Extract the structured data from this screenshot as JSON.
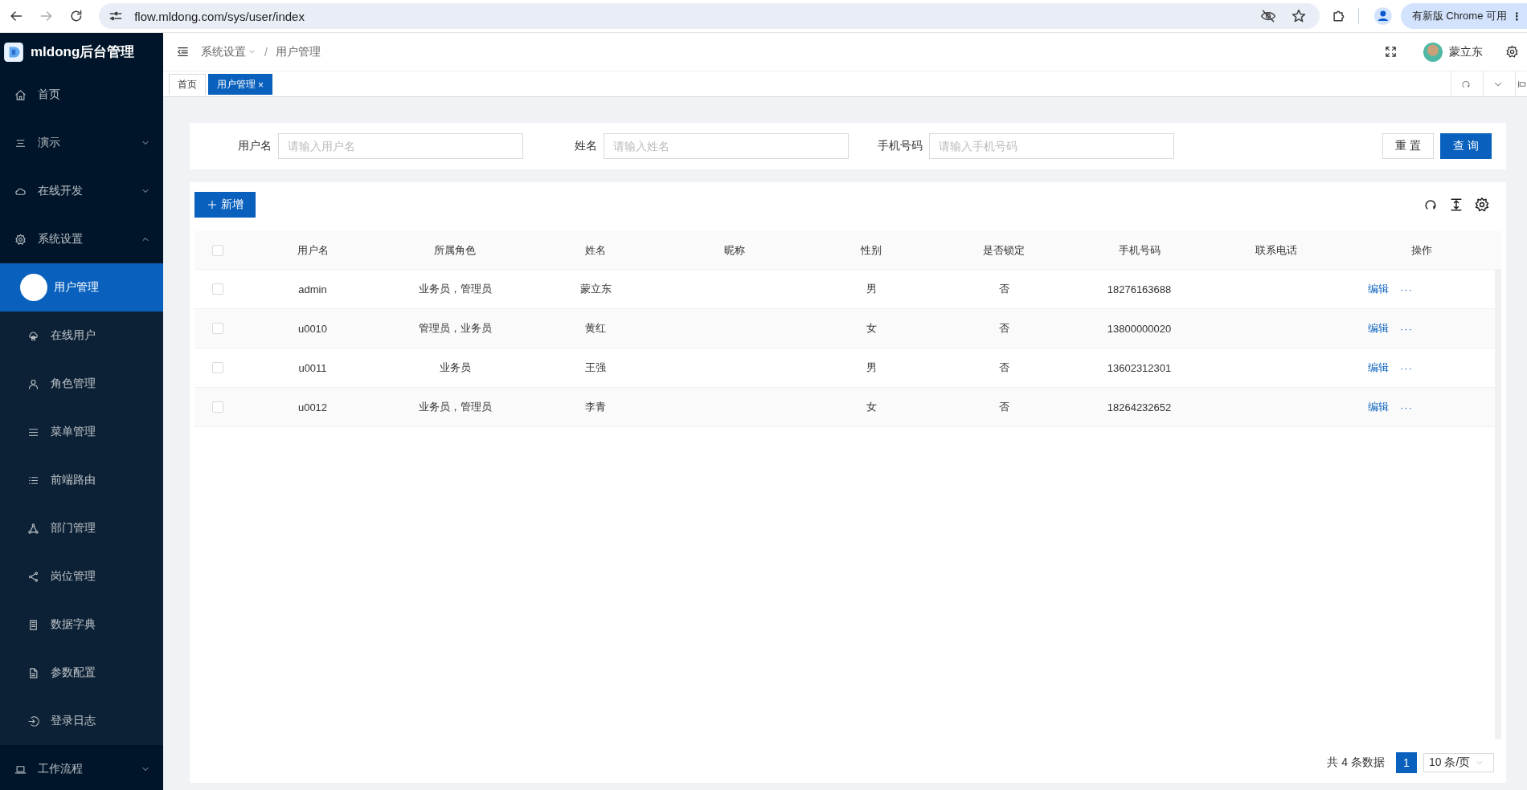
{
  "browser": {
    "url": "flow.mldong.com/sys/user/index",
    "update_notice": "有新版 Chrome 可用",
    "menu": "⋮"
  },
  "app": {
    "title": "mldong后台管理"
  },
  "sidebar": {
    "items": [
      {
        "kind": "item",
        "label": "首页",
        "selected": false
      },
      {
        "kind": "group",
        "label": "演示",
        "expanded": false
      },
      {
        "kind": "group",
        "label": "在线开发",
        "expanded": false
      },
      {
        "kind": "group",
        "label": "系统设置",
        "expanded": true,
        "children": [
          {
            "label": "用户管理",
            "selected": true
          },
          {
            "label": "在线用户",
            "selected": false
          },
          {
            "label": "角色管理",
            "selected": false
          },
          {
            "label": "菜单管理",
            "selected": false
          },
          {
            "label": "前端路由",
            "selected": false
          },
          {
            "label": "部门管理",
            "selected": false
          },
          {
            "label": "岗位管理",
            "selected": false
          },
          {
            "label": "数据字典",
            "selected": false
          },
          {
            "label": "参数配置",
            "selected": false
          },
          {
            "label": "登录日志",
            "selected": false
          }
        ]
      },
      {
        "kind": "group",
        "label": "工作流程",
        "expanded": false
      }
    ]
  },
  "header": {
    "breadcrumb": [
      "系统设置",
      "用户管理"
    ],
    "separator": "/",
    "user": "蒙立东"
  },
  "tabs": [
    {
      "label": "首页",
      "selected": false
    },
    {
      "label": "用户管理",
      "selected": true,
      "close": "×"
    }
  ],
  "filters": [
    {
      "label": "用户名",
      "placeholder": "请输入用户名"
    },
    {
      "label": "姓名",
      "placeholder": "请输入姓名"
    },
    {
      "label": "手机号码",
      "placeholder": "请输入手机号码"
    }
  ],
  "filter_buttons": [
    {
      "label": "重 置",
      "kind": "default"
    },
    {
      "label": "查 询",
      "kind": "primary"
    }
  ],
  "toolbar": {
    "add_button": "新增"
  },
  "table": {
    "header_checked": false,
    "columns": [
      {
        "label": "用户名",
        "kind": "text"
      },
      {
        "label": "所属角色",
        "kind": "text"
      },
      {
        "label": "姓名",
        "kind": "text"
      },
      {
        "label": "昵称",
        "kind": "text"
      },
      {
        "label": "性别",
        "kind": "text"
      },
      {
        "label": "是否锁定",
        "kind": "text"
      },
      {
        "label": "手机号码",
        "kind": "text"
      },
      {
        "label": "联系电话",
        "kind": "text"
      },
      {
        "label": "操作",
        "kind": "actions"
      }
    ],
    "rows": [
      {
        "checked": false,
        "username": "admin",
        "roles": "业务员，管理员",
        "name": "蒙立东",
        "sex": "男",
        "locked": "否",
        "mobile": "18276163688",
        "edit": "编辑",
        "more": "···"
      },
      {
        "checked": false,
        "username": "u0010",
        "roles": "管理员，业务员",
        "name": "黄红",
        "sex": "女",
        "locked": "否",
        "mobile": "13800000020",
        "edit": "编辑",
        "more": "···"
      },
      {
        "checked": false,
        "username": "u0011",
        "roles": "业务员",
        "name": "王强",
        "sex": "男",
        "locked": "否",
        "mobile": "13602312301",
        "edit": "编辑",
        "more": "···"
      },
      {
        "checked": false,
        "username": "u0012",
        "roles": "业务员，管理员",
        "name": "李青",
        "sex": "女",
        "locked": "否",
        "mobile": "18264232652",
        "edit": "编辑",
        "more": "···"
      }
    ]
  },
  "pagination": {
    "total": "共 4 条数据",
    "pages": [
      {
        "label": "1",
        "selected": true
      }
    ],
    "page_size": "10 条/页"
  }
}
